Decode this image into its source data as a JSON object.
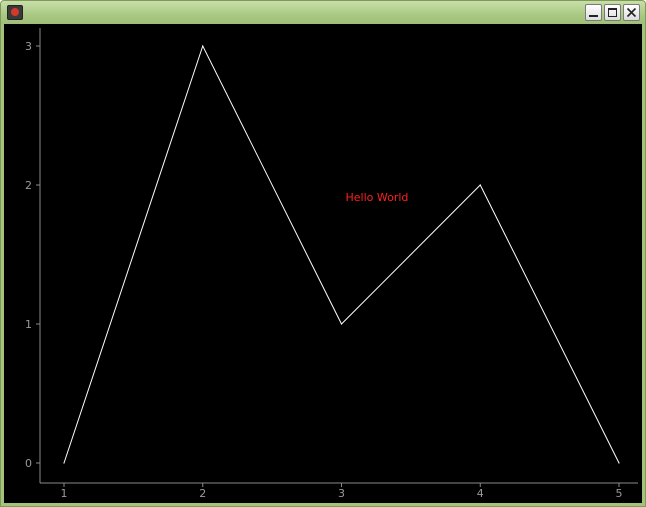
{
  "window": {
    "title": "",
    "icon": "app-icon",
    "buttons": [
      "minimize-icon",
      "maximize-icon",
      "close-icon"
    ]
  },
  "colors": {
    "frame": "#a4c27a",
    "background": "#000000",
    "line": "#ffffff",
    "axis": "#8a8a8a",
    "annotation": "#ff2020"
  },
  "chart_data": {
    "type": "line",
    "title": "",
    "xlabel": "",
    "ylabel": "",
    "x": [
      1,
      2,
      3,
      4,
      5
    ],
    "y": [
      0,
      3,
      1,
      2,
      0
    ],
    "xlim": [
      1,
      5
    ],
    "ylim": [
      0,
      3
    ],
    "x_ticks": [
      "1",
      "2",
      "3",
      "4",
      "5"
    ],
    "y_ticks": [
      "0",
      "1",
      "2",
      "3"
    ],
    "grid": false,
    "annotation": {
      "text": "Hello World",
      "x": 3,
      "y": 2
    }
  }
}
